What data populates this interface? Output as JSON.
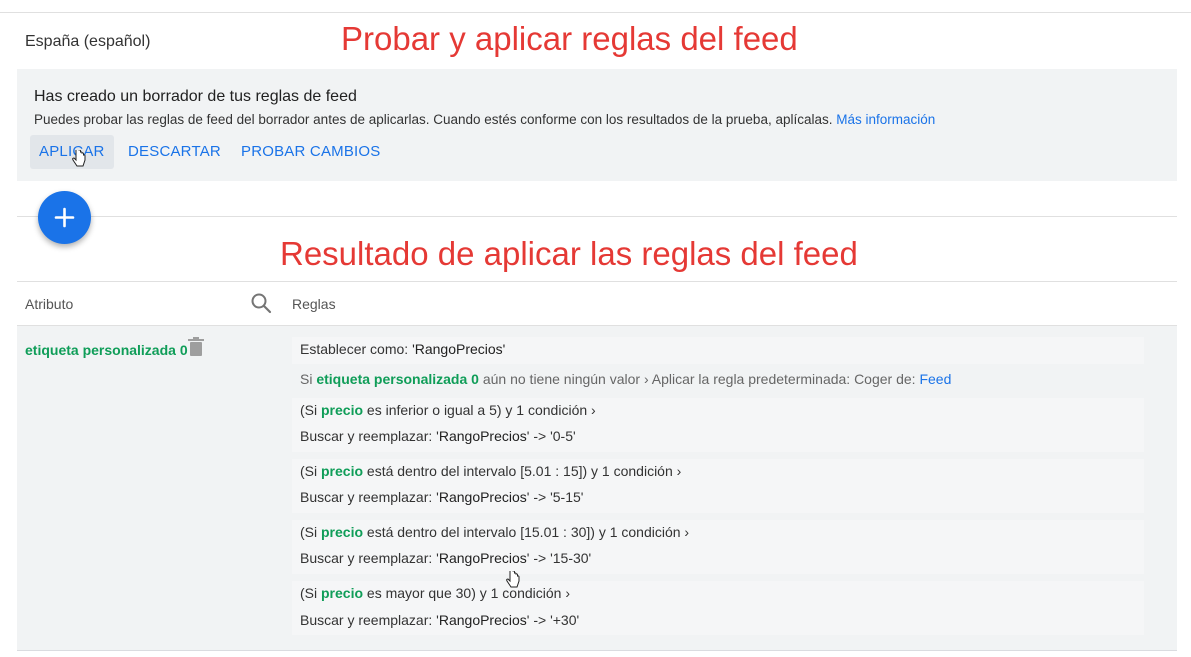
{
  "header": {
    "country": "España (español)"
  },
  "annotations": {
    "top": "Probar y aplicar reglas del feed",
    "middle": "Resultado de aplicar las reglas del feed"
  },
  "banner": {
    "title": "Has creado un borrador de tus reglas de feed",
    "description": "Puedes probar las reglas de feed del borrador antes de aplicarlas. Cuando estés conforme con los resultados de la prueba, aplícalas.",
    "link": "Más información",
    "buttons": {
      "apply": "APLICAR",
      "discard": "DESCARTAR",
      "test": "PROBAR CAMBIOS"
    }
  },
  "table": {
    "col_attribute": "Atributo",
    "col_rules": "Reglas"
  },
  "attribute": {
    "name": "etiqueta personalizada 0",
    "set_as": {
      "prefix": "Establecer como: ",
      "value": "'RangoPrecios'"
    },
    "default_rule": {
      "prefix": "Si ",
      "attr": "etiqueta personalizada 0",
      "middle": " aún no tiene ningún valor › Aplicar la regla predeterminada: Coger de: ",
      "source": "Feed"
    },
    "rules": [
      {
        "cond_open": "(Si ",
        "field": "precio",
        "cond_rest": " es inferior o igual a 5) y 1 condición ›",
        "action_prefix": "Buscar y reemplazar: '",
        "find": "RangoPrecios",
        "replace": "' -> '0-5'"
      },
      {
        "cond_open": "(Si ",
        "field": "precio",
        "cond_rest": " está dentro del intervalo [5.01 : 15]) y 1 condición ›",
        "action_prefix": "Buscar y reemplazar: '",
        "find": "RangoPrecios",
        "replace": "' -> '5-15'"
      },
      {
        "cond_open": "(Si ",
        "field": "precio",
        "cond_rest": " está dentro del intervalo [15.01 : 30]) y 1 condición ›",
        "action_prefix": "Buscar y reemplazar: '",
        "find": "RangoPrecios",
        "replace": "' -> '15-30'"
      },
      {
        "cond_open": "(Si ",
        "field": "precio",
        "cond_rest": " es mayor que 30) y 1 condición ›",
        "action_prefix": "Buscar y reemplazar: '",
        "find": "RangoPrecios",
        "replace": "' -> '+30'"
      }
    ]
  },
  "colors": {
    "accent_blue": "#1a73e8",
    "attribute_green": "#0f9d58",
    "annotation_red": "#e53935"
  },
  "icons": [
    "add-icon",
    "search-icon",
    "trash-icon",
    "hand-cursor-icon"
  ]
}
